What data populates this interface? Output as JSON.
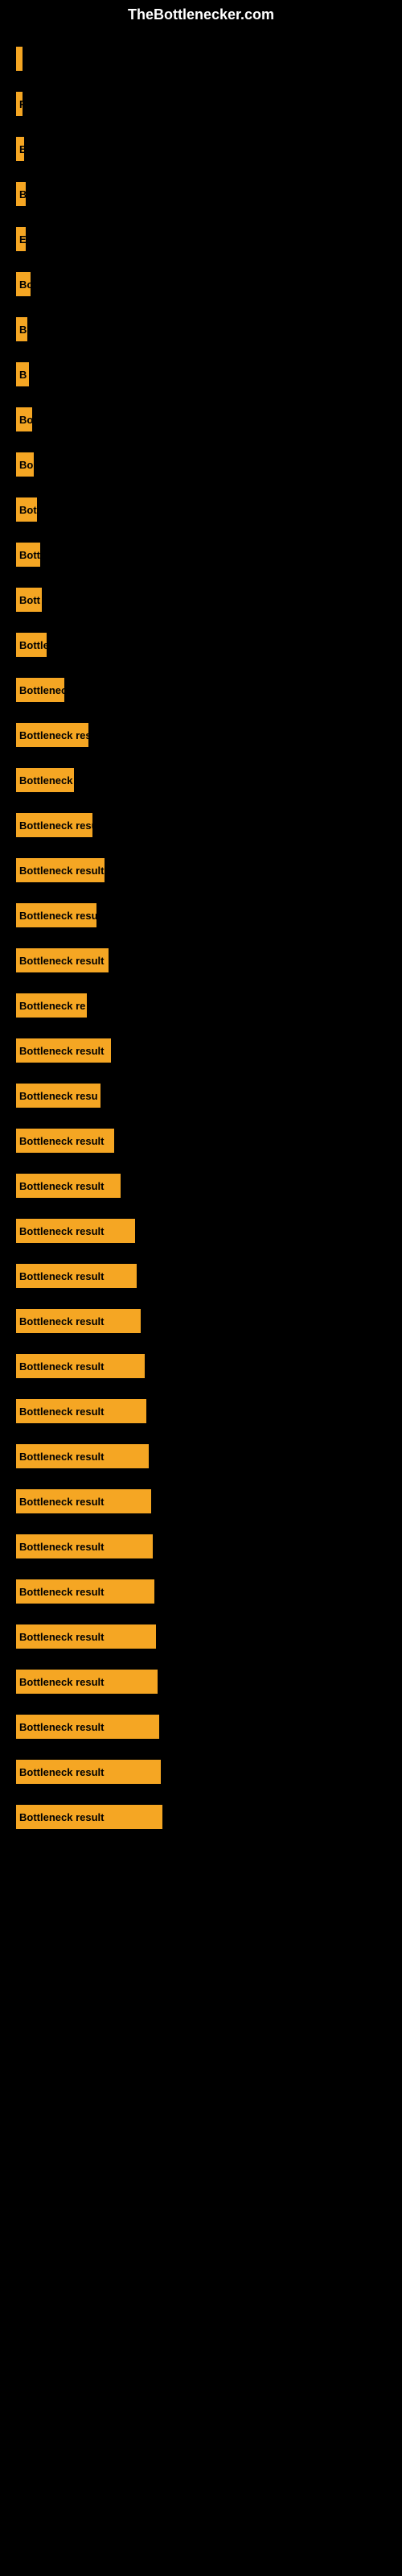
{
  "site": {
    "title": "TheBottlenecker.com"
  },
  "bars": [
    {
      "label": "",
      "width": 2
    },
    {
      "label": "F",
      "width": 8
    },
    {
      "label": "E",
      "width": 10
    },
    {
      "label": "B",
      "width": 12
    },
    {
      "label": "E",
      "width": 12
    },
    {
      "label": "Bo",
      "width": 18
    },
    {
      "label": "B",
      "width": 14
    },
    {
      "label": "B",
      "width": 16
    },
    {
      "label": "Bo",
      "width": 20
    },
    {
      "label": "Bo",
      "width": 22
    },
    {
      "label": "Bot",
      "width": 26
    },
    {
      "label": "Bott",
      "width": 30
    },
    {
      "label": "Bott",
      "width": 32
    },
    {
      "label": "Bottle",
      "width": 38
    },
    {
      "label": "Bottlenec",
      "width": 60
    },
    {
      "label": "Bottleneck res",
      "width": 90
    },
    {
      "label": "Bottleneck",
      "width": 72
    },
    {
      "label": "Bottleneck resu",
      "width": 95
    },
    {
      "label": "Bottleneck result",
      "width": 110
    },
    {
      "label": "Bottleneck resu",
      "width": 100
    },
    {
      "label": "Bottleneck result",
      "width": 115
    },
    {
      "label": "Bottleneck re",
      "width": 88
    },
    {
      "label": "Bottleneck result",
      "width": 118
    },
    {
      "label": "Bottleneck resu",
      "width": 105
    },
    {
      "label": "Bottleneck result",
      "width": 122
    },
    {
      "label": "Bottleneck result",
      "width": 130
    },
    {
      "label": "Bottleneck result",
      "width": 148
    },
    {
      "label": "Bottleneck result",
      "width": 150
    },
    {
      "label": "Bottleneck result",
      "width": 155
    },
    {
      "label": "Bottleneck result",
      "width": 160
    },
    {
      "label": "Bottleneck result",
      "width": 162
    },
    {
      "label": "Bottleneck result",
      "width": 165
    },
    {
      "label": "Bottleneck result",
      "width": 168
    },
    {
      "label": "Bottleneck result",
      "width": 170
    },
    {
      "label": "Bottleneck result",
      "width": 172
    },
    {
      "label": "Bottleneck result",
      "width": 174
    },
    {
      "label": "Bottleneck result",
      "width": 176
    },
    {
      "label": "Bottleneck result",
      "width": 178
    },
    {
      "label": "Bottleneck result",
      "width": 180
    },
    {
      "label": "Bottleneck result",
      "width": 182
    }
  ]
}
